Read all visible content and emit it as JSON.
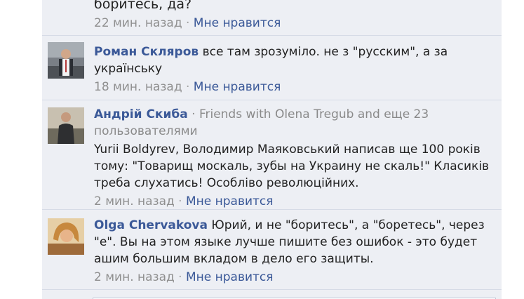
{
  "thread": {
    "prev_comment_tail": "боритесь, да?",
    "prev_time": "22 мин. назад",
    "separator": "·",
    "prev_like": "Мне нравится"
  },
  "comments": [
    {
      "author": "Роман Скляров",
      "text": "все там зрозуміло. не з \"русским\", а за українську",
      "time": "18 мин. назад",
      "like": "Мне нравится"
    },
    {
      "author": "Андрій Скиба",
      "friends": "· Friends with Olena Tregub and еще 23 пользователями",
      "text": "Yurii Boldyrev, Володимир Маяковський написав ще 100 років тому: \"Товарищ москаль, зубы на Украину не скаль!\" Класиків треба слухатись! Особліво революційних.",
      "time": "2 мин. назад",
      "like": "Мне нравится"
    },
    {
      "author": "Olga Chervakova",
      "text": "Юрий, и не \"боритесь\", а \"боретесь\", через \"е\". Вы на этом языке лучше пишите без ошибок - это будет ашим большим вкладом в дело его защиты.",
      "time": "2 мин. назад",
      "like": "Мне нравится"
    }
  ],
  "colors": {
    "panel_bg": "#edeff4",
    "author_link": "#3b5998",
    "meta_gray": "#8f8f8f",
    "divider": "#d6dbe6"
  }
}
